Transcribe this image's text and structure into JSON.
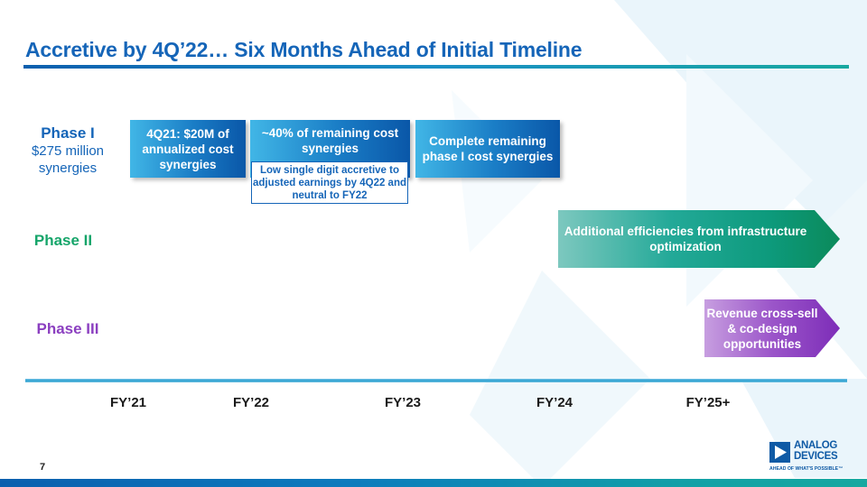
{
  "slide": {
    "title": "Accretive by 4Q’22… Six Months Ahead of Initial Timeline",
    "page_number": "7"
  },
  "phases": [
    {
      "label": "Phase I",
      "sub": "$275 million synergies",
      "color": "#1565b8"
    },
    {
      "label": "Phase II",
      "color": "#16a56a"
    },
    {
      "label": "Phase III",
      "color": "#8b3fc0"
    }
  ],
  "phase1_boxes": [
    {
      "text": "4Q21: $20M of annualized cost synergies"
    },
    {
      "text": "~40% of remaining cost synergies"
    },
    {
      "text": "Complete remaining phase I cost synergies"
    }
  ],
  "phase1_note": "Low single digit accretive to adjusted earnings by 4Q22 and neutral to FY22",
  "phase2_arrow": "Additional efficiencies from infrastructure optimization",
  "phase3_arrow": "Revenue cross-sell & co-design opportunities",
  "timeline": {
    "labels": [
      "FY’21",
      "FY’22",
      "FY’23",
      "FY’24",
      "FY’25+"
    ]
  },
  "logo": {
    "line1": "ANALOG",
    "line2": "DEVICES",
    "tagline": "AHEAD OF WHAT'S POSSIBLE™",
    "color": "#0f5aa5"
  }
}
